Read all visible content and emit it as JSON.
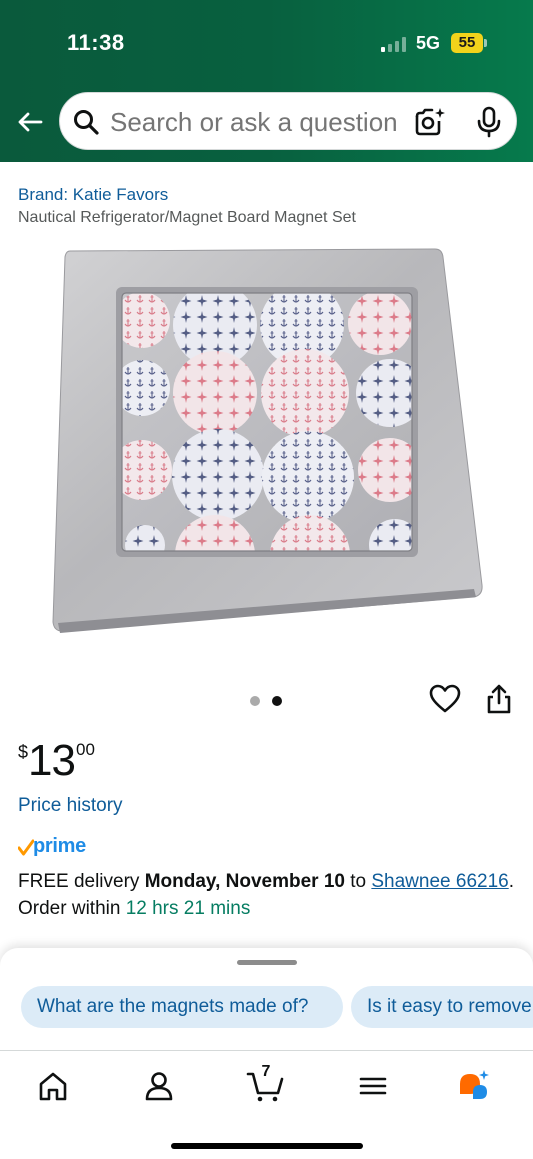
{
  "status_bar": {
    "time": "11:38",
    "network": "5G",
    "battery": "55"
  },
  "search": {
    "placeholder": "Search or ask a question"
  },
  "product": {
    "brand": "Brand: Katie Favors",
    "title": "Nautical Refrigerator/Magnet Board Magnet Set",
    "image_count": 2,
    "active_image": 2
  },
  "price": {
    "symbol": "$",
    "whole": "13",
    "fraction": "00"
  },
  "price_history_label": "Price history",
  "prime_label": "prime",
  "delivery": {
    "prefix": "FREE delivery ",
    "date": "Monday, November 10",
    "to": " to ",
    "location": "Shawnee 66216",
    "order_within": ". Order within ",
    "countdown": "12 hrs 21 mins"
  },
  "suggestions": [
    "What are the magnets made of?",
    "Is it easy to remove"
  ],
  "cart": {
    "count": "7"
  },
  "colors": {
    "header_green": "#0a5a3c",
    "link_blue": "#0f5c99",
    "prime_blue": "#1f8ce6",
    "countdown_green": "#067d62",
    "chip_bg": "#dcebf7",
    "battery_yellow": "#f2d31b",
    "rufus_orange": "#ff6a00",
    "rufus_blue": "#1f8ce6"
  },
  "icons": {
    "back": "arrow-left-icon",
    "search": "magnifier-icon",
    "camera": "camera-sparkle-icon",
    "mic": "microphone-icon",
    "heart": "heart-icon",
    "share": "share-icon",
    "home": "home-icon",
    "account": "person-icon",
    "cart": "cart-icon",
    "menu": "hamburger-icon",
    "rufus": "rufus-chat-icon"
  }
}
